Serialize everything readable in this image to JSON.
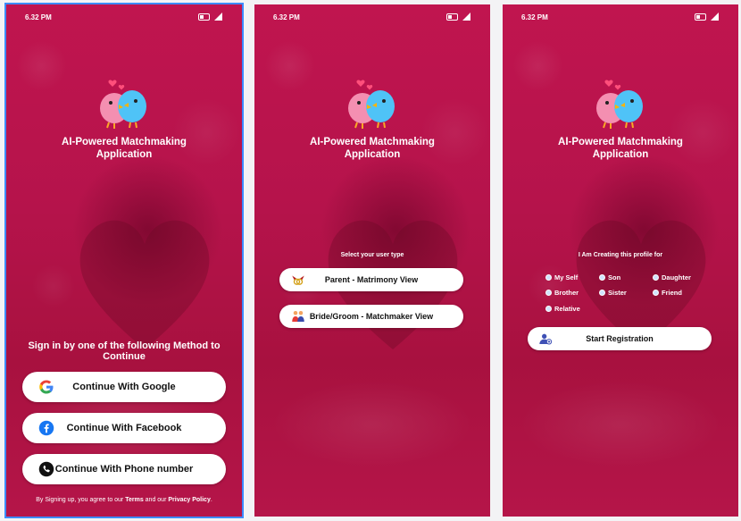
{
  "status_bar": {
    "time": "6.32 PM"
  },
  "app": {
    "title_line1": "AI-Powered Matchmaking",
    "title_line2": "Application"
  },
  "screen1": {
    "heading": "Sign in by one of the following Method to Continue",
    "google_label": "Continue With Google",
    "facebook_label": "Continue With Facebook",
    "phone_label": "Continue With Phone number",
    "terms_prefix": "By Signing up, you agree to our ",
    "terms_link": "Terms",
    "terms_middle": " and our ",
    "privacy_link": "Privacy Policy",
    "terms_suffix": "."
  },
  "screen2": {
    "prompt": "Select your user type",
    "parent_label": "Parent - Matrimony View",
    "bride_label": "Bride/Groom - Matchmaker View"
  },
  "screen3": {
    "prompt": "I Am Creating this profile for",
    "options": [
      "My Self",
      "Son",
      "Daughter",
      "Brother",
      "Sister",
      "Friend",
      "Relative"
    ],
    "start_label": "Start Registration"
  },
  "colors": {
    "background": "#b5134b",
    "accent_outline": "#3d8bff",
    "button_bg": "#ffffff",
    "google_blue": "#4285F4",
    "facebook_blue": "#1877F2"
  },
  "icons": {
    "logo": "love-birds-icon",
    "google": "google-icon",
    "facebook": "facebook-icon",
    "phone": "phone-icon",
    "parent": "rings-icon",
    "bride": "couple-icon",
    "start": "add-user-icon"
  }
}
